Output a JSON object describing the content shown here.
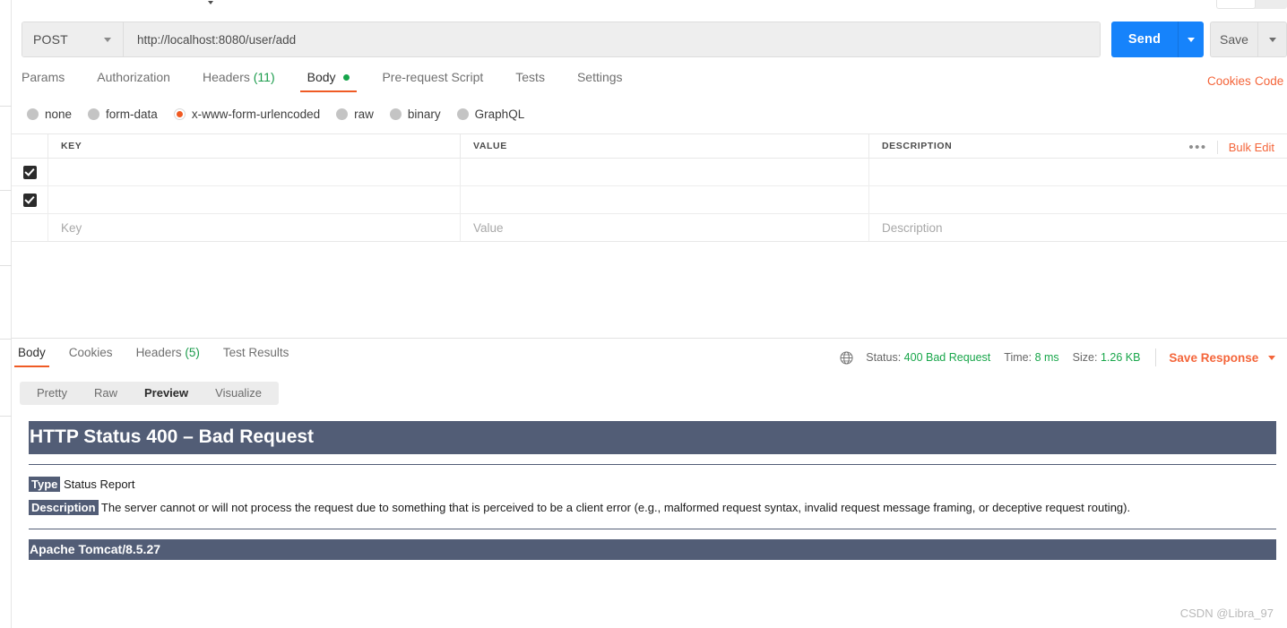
{
  "request": {
    "method": "POST",
    "url": "http://localhost:8080/user/add",
    "send_label": "Send",
    "save_label": "Save",
    "tabs": [
      {
        "label": "Params",
        "count": "",
        "active": false
      },
      {
        "label": "Authorization",
        "count": "",
        "active": false
      },
      {
        "label": "Headers",
        "count": "(11)",
        "active": false
      },
      {
        "label": "Body",
        "count": "",
        "active": true,
        "dot": true
      },
      {
        "label": "Pre-request Script",
        "count": "",
        "active": false
      },
      {
        "label": "Tests",
        "count": "",
        "active": false
      },
      {
        "label": "Settings",
        "count": "",
        "active": false
      }
    ],
    "cookies_link": "Cookies",
    "code_link": "Code",
    "body_types": [
      {
        "label": "none",
        "selected": false
      },
      {
        "label": "form-data",
        "selected": false
      },
      {
        "label": "x-www-form-urlencoded",
        "selected": true
      },
      {
        "label": "raw",
        "selected": false
      },
      {
        "label": "binary",
        "selected": false
      },
      {
        "label": "GraphQL",
        "selected": false
      }
    ],
    "table": {
      "headers": {
        "key": "KEY",
        "value": "VALUE",
        "description": "DESCRIPTION"
      },
      "ellipsis": "•••",
      "bulk_edit": "Bulk Edit",
      "rows": [
        {
          "checked": true,
          "key": "",
          "value": "",
          "description": ""
        },
        {
          "checked": true,
          "key": "",
          "value": "",
          "description": ""
        }
      ],
      "new_row": {
        "key": "Key",
        "value": "Value",
        "description": "Description"
      }
    }
  },
  "response": {
    "tabs": [
      {
        "label": "Body",
        "count": "",
        "active": true
      },
      {
        "label": "Cookies",
        "count": "",
        "active": false
      },
      {
        "label": "Headers",
        "count": "(5)",
        "active": false
      },
      {
        "label": "Test Results",
        "count": "",
        "active": false
      }
    ],
    "view_modes": [
      {
        "label": "Pretty",
        "active": false
      },
      {
        "label": "Raw",
        "active": false
      },
      {
        "label": "Preview",
        "active": true
      },
      {
        "label": "Visualize",
        "active": false
      }
    ],
    "meta": {
      "status_label": "Status:",
      "status_value": "400 Bad Request",
      "time_label": "Time:",
      "time_value": "8 ms",
      "size_label": "Size:",
      "size_value": "1.26 KB",
      "save_response": "Save Response"
    },
    "preview": {
      "banner": "HTTP Status 400 – Bad Request",
      "type_tag": "Type",
      "type_text": "Status Report",
      "description_tag": "Description",
      "description_text": "The server cannot or will not process the request due to something that is perceived to be a client error (e.g., malformed request syntax, invalid request message framing, or deceptive request routing).",
      "footer": "Apache Tomcat/8.5.27"
    }
  },
  "watermark": "CSDN @Libra_97",
  "colors": {
    "accent_orange": "#f4653a",
    "send_blue": "#1683fb",
    "status_green": "#18a64a",
    "tomcat_slate": "#525d76"
  }
}
